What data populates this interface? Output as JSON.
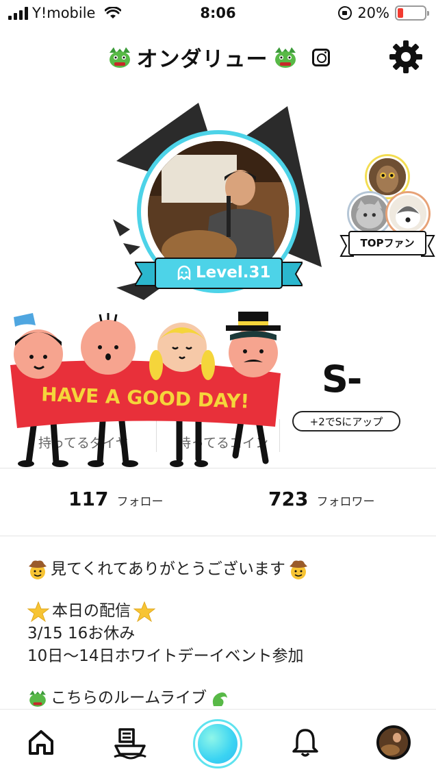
{
  "status": {
    "carrier": "Y!mobile",
    "time": "8:06",
    "battery": "20%",
    "battery_level": 0.2
  },
  "header": {
    "title": "オンダリュー"
  },
  "profile": {
    "level": "Level.31",
    "top_fan_label": "TOPファン",
    "rank": "S-",
    "rank_up": "+2でSにアップ",
    "stat_diamond_label": "持ってるダイヤ",
    "stat_coin_label": "持ってるコイン"
  },
  "sticker": {
    "text": "HAVE A GOOD DAY!"
  },
  "follow": {
    "following_count": "117",
    "following_label": "フォロー",
    "followers_count": "723",
    "followers_label": "フォロワー"
  },
  "bio": {
    "line1": "見てくれてありがとうございます",
    "line2": "本日の配信",
    "line3": "3/15 16お休み",
    "line4": "10日〜14日ホワイトデーイベント参加",
    "line5": "こちらのルームライブ"
  },
  "colors": {
    "accent": "#4dd3e8",
    "battery_low": "#f23b30",
    "sticker_red": "#e8303a",
    "sticker_text": "#f5d53b"
  },
  "nav": {
    "items": [
      "home-icon",
      "ship-icon",
      "record-button",
      "bell-icon",
      "profile-avatar"
    ]
  }
}
